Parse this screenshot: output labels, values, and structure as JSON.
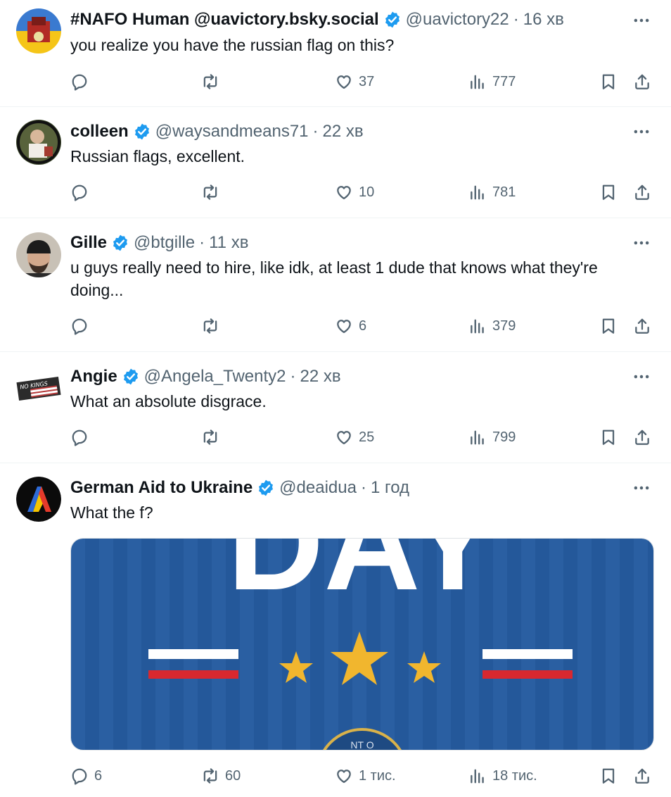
{
  "tweets": [
    {
      "name": "#NAFO Human @uavictory.bsky.social",
      "handle": "@uavictory22",
      "dot": "·",
      "time": "16 хв",
      "text": "you realize you have the russian flag on this?",
      "stats": {
        "replies": "",
        "reposts": "",
        "likes": "37",
        "views": "777"
      }
    },
    {
      "name": "colleen",
      "handle": "@waysandmeans71",
      "dot": "·",
      "time": "22 хв",
      "text": "Russian flags, excellent.",
      "stats": {
        "replies": "",
        "reposts": "",
        "likes": "10",
        "views": "781"
      }
    },
    {
      "name": "Gille",
      "handle": "@btgille",
      "dot": "·",
      "time": "11 хв",
      "text": "u guys really need to hire, like idk, at least 1 dude that knows what they're doing...",
      "stats": {
        "replies": "",
        "reposts": "",
        "likes": "6",
        "views": "379"
      }
    },
    {
      "name": "Angie",
      "handle": "@Angela_Twenty2",
      "dot": "·",
      "time": "22 хв",
      "text": "What an absolute disgrace.",
      "stats": {
        "replies": "",
        "reposts": "",
        "likes": "25",
        "views": "799"
      }
    },
    {
      "name": "German Aid to Ukraine",
      "handle": "@deaidua",
      "dot": "·",
      "time": "1 год",
      "text": "What the f?",
      "stats": {
        "replies": "6",
        "reposts": "60",
        "likes": "1 тис.",
        "views": "18 тис."
      }
    }
  ],
  "avatar_texts": {
    "angie": "NO KINGS"
  },
  "media": {
    "headline_fragment": "DAY",
    "seal_fragment": "NT O"
  },
  "icons": [
    "reply-icon",
    "repost-icon",
    "like-icon",
    "views-icon",
    "bookmark-icon",
    "share-icon",
    "more-icon",
    "verified-badge-icon"
  ],
  "colors": {
    "text": "#0f1419",
    "muted": "#536471",
    "verified": "#1d9bf0",
    "divider": "#eff3f4",
    "media_blue": "#24589a",
    "star": "#f1b62e",
    "flag_red": "#d8282f"
  }
}
